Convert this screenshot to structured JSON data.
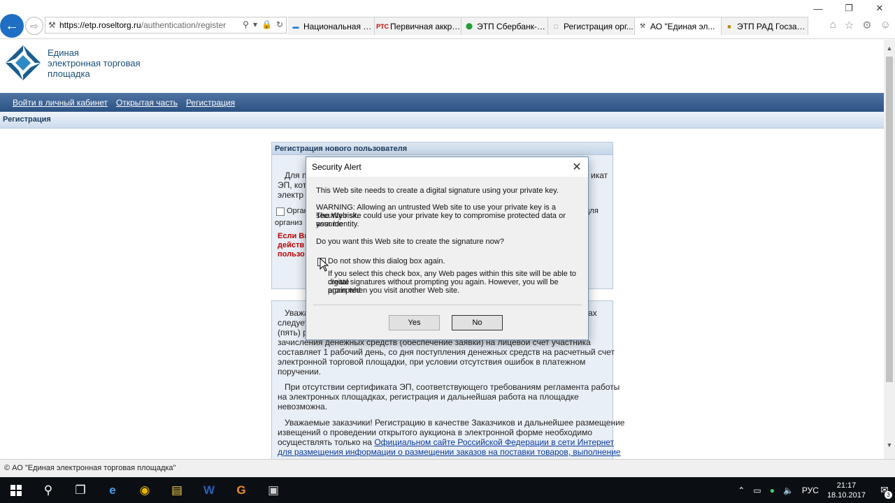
{
  "browser": {
    "url_main": "https://etp.roseltorg.ru",
    "url_rest": "/authentication/register",
    "tabs": [
      {
        "label": "Национальная э...",
        "icon": "gov-globe-icon",
        "active": false
      },
      {
        "label": "Первичная аккре...",
        "icon": "rts-icon",
        "active": false
      },
      {
        "label": "ЭТП Сбербанк-А...",
        "icon": "sberbank-icon",
        "active": false
      },
      {
        "label": "Регистрация орг...",
        "icon": "page-icon",
        "active": false
      },
      {
        "label": "АО \"Единая эл...",
        "icon": "gavel-icon",
        "active": true
      },
      {
        "label": "ЭТП РАД Госзаку...",
        "icon": "rad-icon",
        "active": false
      }
    ],
    "icons": {
      "back": "back-arrow-icon",
      "forward": "forward-arrow-icon",
      "home": "home-icon",
      "favorites": "star-icon",
      "settings": "gear-icon",
      "feedback": "smiley-icon"
    },
    "accent_color": "#1e6fc4"
  },
  "site": {
    "logo_lines": [
      "Единая",
      "электронная торговая",
      "площадка"
    ],
    "nav": [
      "Войти в личный кабинет",
      "Открытая часть",
      "Регистрация"
    ],
    "breadcrumb": "Регистрация",
    "nav_color": "#2b5283"
  },
  "panel1": {
    "title": "Регистрация нового пользователя",
    "frag1": "Для п",
    "frag2": "ЭП, кот",
    "frag3": "электр",
    "frag4": "Орган",
    "frag5": "организ",
    "red1": "Если Вы",
    "red2": "действ",
    "red3": "пользо",
    "right1": "икат",
    "right2": "для"
  },
  "panel2": {
    "lines": [
      "Уважа",
      "следует",
      "(пять) р",
      "зачисления денежных средств (обеспечение заявки) на лицевой счет участника",
      "составляет 1 рабочий день, со дня поступления денежных средств на расчетный счет",
      "электронной торговой площадки, при условии отсутствия ошибок в платежном",
      "поручении.",
      "При отсутствии сертификата ЭП, соответствующего требованиям регламента работы",
      "на электронных площадках, регистрация и дальнейшая работа на площадке",
      "невозможна.",
      "Уважаемые заказчики! Регистрацию в качестве Заказчиков и дальнейшее размещение",
      "извещений о проведении открытого аукциона в электронной форме необходимо",
      "осуществлять только на "
    ],
    "link1": "Официальном сайте Российской Федерации в сети Интернет",
    "link2": "для размещения информации о размещении заказов на поставки товаров, выполнение",
    "right_frag": "ах"
  },
  "footer": "© АО \"Единая электронная торговая площадка\"",
  "dialog": {
    "title": "Security Alert",
    "line1": "This Web site needs to create a digital signature using your private key.",
    "warn1": "WARNING: Allowing an untrusted Web site to use your private key is a security risk.",
    "warn2": "The Web site could use your private key to compromise protected data or assume",
    "warn3": "your identity.",
    "question": "Do you want this Web site to create the signature now?",
    "checkbox_label": "Do not show this dialog box again.",
    "note1": "If you select this check box, any Web pages within this site will be able to create",
    "note2": "digital signatures without prompting you again. However, you will be prompted",
    "note3": "again when you visit another Web site.",
    "yes": "Yes",
    "no": "No",
    "checkbox_checked": false
  },
  "taskbar": {
    "apps": [
      "windows-start-icon",
      "search-icon",
      "task-view-icon",
      "edge-icon",
      "chrome-icon",
      "file-explorer-icon",
      "word-icon",
      "app-icon",
      "media-icon"
    ],
    "lang": "РУС",
    "time": "21:17",
    "date": "18.10.2017",
    "notifications": "3"
  }
}
